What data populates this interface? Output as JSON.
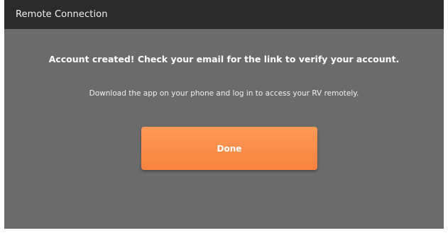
{
  "header": {
    "title": "Remote Connection"
  },
  "main": {
    "heading": "Account created! Check your email for the link to verify your account.",
    "subtext": "Download the app on your phone and log in to access your RV remotely.",
    "done_label": "Done"
  },
  "colors": {
    "titlebar": "#2b2b2b",
    "panel": "#6b6b6b",
    "accent": "#f7833f"
  }
}
